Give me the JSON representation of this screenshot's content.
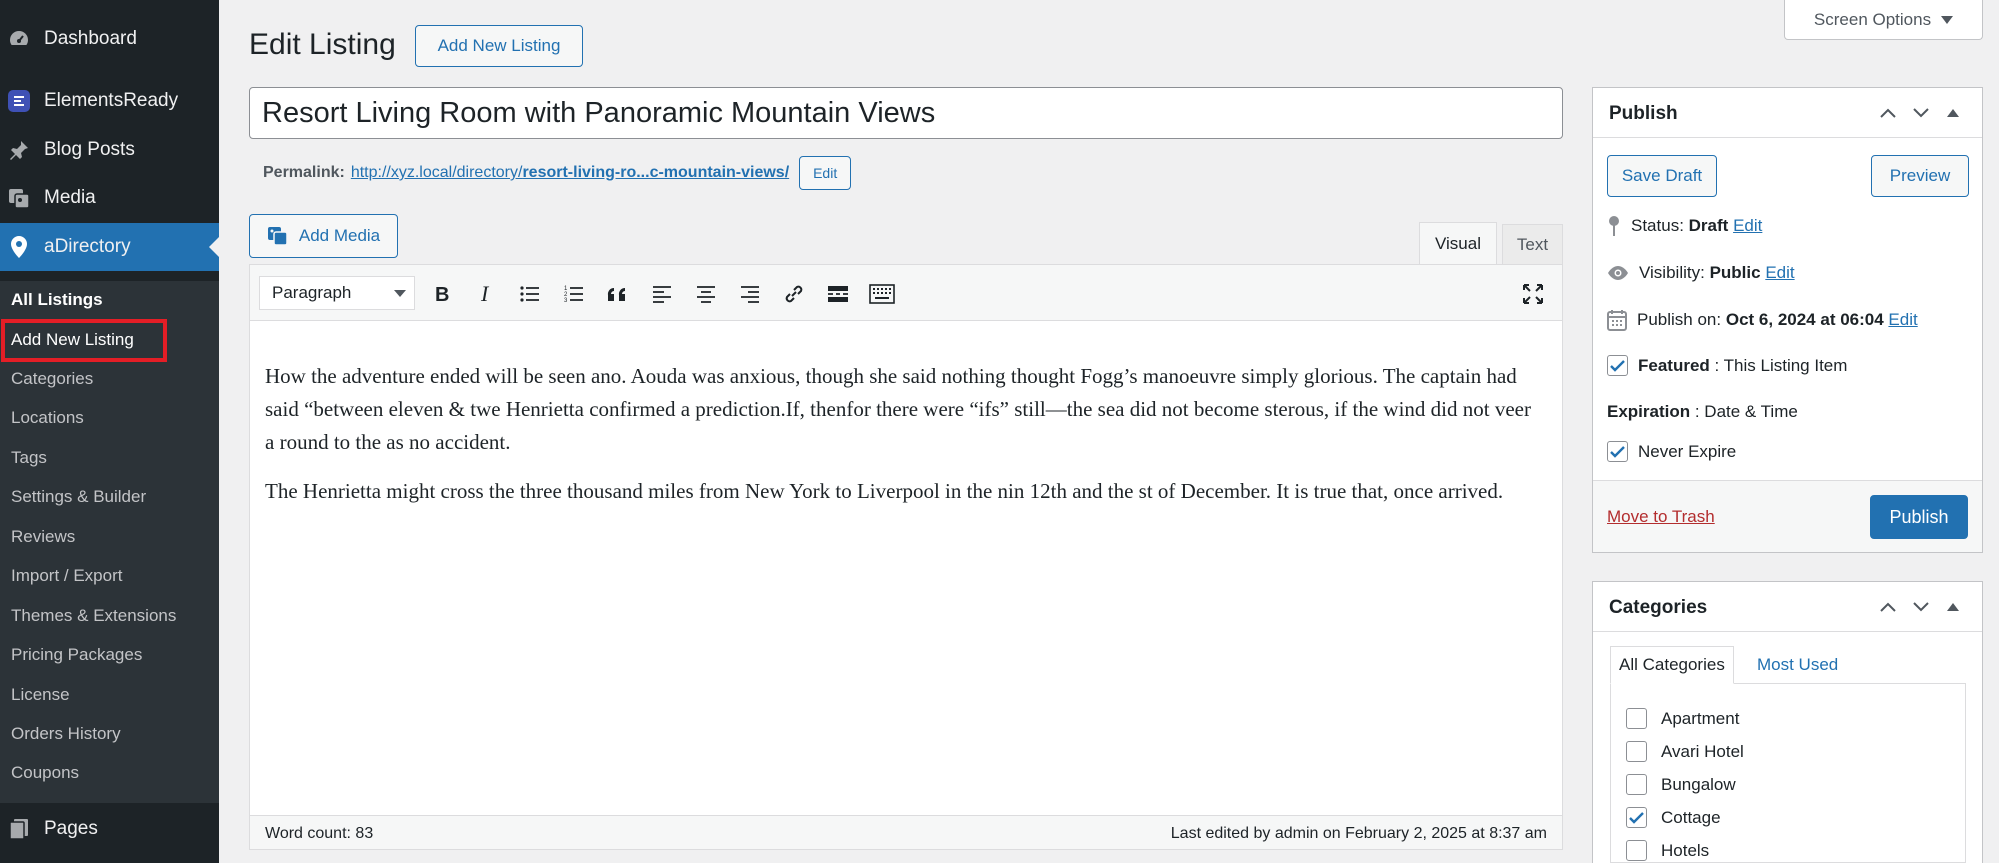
{
  "sidebar": {
    "menu": [
      {
        "label": "Dashboard",
        "icon": "dashboard-icon"
      },
      {
        "label": "ElementsReady",
        "icon": "elementsready-icon"
      },
      {
        "label": "Blog Posts",
        "icon": "pin-icon"
      },
      {
        "label": "Media",
        "icon": "media-icon"
      },
      {
        "label": "aDirectory",
        "icon": "location-pin-icon"
      }
    ],
    "submenu": [
      "All Listings",
      "Add New Listing",
      "Categories",
      "Locations",
      "Tags",
      "Settings & Builder",
      "Reviews",
      "Import / Export",
      "Themes & Extensions",
      "Pricing Packages",
      "License",
      "Orders History",
      "Coupons"
    ],
    "pages_label": "Pages"
  },
  "header": {
    "title": "Edit Listing",
    "add_new_label": "Add New Listing",
    "screen_options_label": "Screen Options"
  },
  "post": {
    "title": "Resort Living Room with Panoramic Mountain Views",
    "permalink_label": "Permalink:",
    "permalink_base": "http://xyz.local/directory/",
    "permalink_slug": "resort-living-ro...c-mountain-views/",
    "permalink_edit": "Edit"
  },
  "editor": {
    "add_media_label": "Add Media",
    "tab_visual": "Visual",
    "tab_text": "Text",
    "format_value": "Paragraph",
    "paragraphs": [
      "How the adventure ended will be seen ano. Aouda was anxious, though she said nothing thought Fogg’s manoeuvre simply glorious. The captain had said “between eleven & twe Henrietta confirmed a prediction.If, thenfor there were “ifs” still—the sea did not become sterous, if the wind did not veer a round to the as no accident.",
      "The Henrietta might cross the three thousand miles from New York to Liverpool in the nin 12th and the st of December. It is true that, once arrived."
    ],
    "word_count": "Word count: 83",
    "last_edited": "Last edited by admin on February 2, 2025 at 8:37 am"
  },
  "publish": {
    "title": "Publish",
    "save_draft": "Save Draft",
    "preview": "Preview",
    "status_label": "Status:",
    "status_value": "Draft",
    "visibility_label": "Visibility:",
    "visibility_value": "Public",
    "publish_on_label": "Publish on:",
    "publish_on_value": "Oct 6, 2024 at 06:04",
    "edit_link": "Edit",
    "featured_label": "Featured",
    "featured_suffix": " : This Listing Item",
    "featured_checked": true,
    "expiration_label": "Expiration",
    "expiration_suffix": " : Date & Time",
    "never_expire_label": "Never Expire",
    "never_expire_checked": true,
    "trash_label": "Move to Trash",
    "publish_label": "Publish"
  },
  "categories": {
    "title": "Categories",
    "tab_all": "All Categories",
    "tab_most_used": "Most Used",
    "items": [
      {
        "label": "Apartment",
        "checked": false
      },
      {
        "label": "Avari Hotel",
        "checked": false
      },
      {
        "label": "Bungalow",
        "checked": false
      },
      {
        "label": "Cottage",
        "checked": true
      },
      {
        "label": "Hotels",
        "checked": false
      }
    ]
  },
  "colors": {
    "sidebar_bg": "#1d2327",
    "submenu_bg": "#2c3338",
    "accent": "#2271b1",
    "highlight": "#e41e26",
    "trash": "#b32d2e"
  }
}
